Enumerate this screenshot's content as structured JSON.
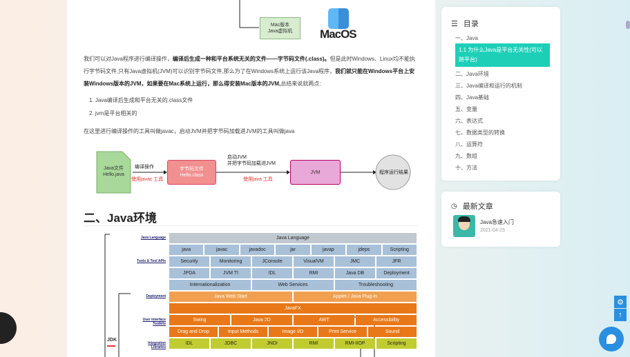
{
  "article": {
    "macos_box": "Mac版本\nJava虚拟机",
    "macos_logo": "MacOS",
    "para1_a": "我们可以对Java程序进行编译操作，",
    "para1_b": "编译后生成一种和平台系统无关的文件——字节码文件(.class)。",
    "para1_c": "但是此时Windows、Linux均不能执行字节码文件,只有Java虚拟机(JVM)可以识别字节码文件,那么为了在Windows系统上运行该Java程序，",
    "para1_d": "我们就只能在Windows平台上安装Windows版本的JVM，如果要在Mac系统上运行，那么得安装Mac版本的JVM,",
    "para1_e": "总结来说就两点:",
    "list": [
      "1. Java编译后生成和平台无关的.class文件",
      "2. jvm是平台相关的"
    ],
    "para2": "在这里进行编译操作的工具叫做javac，启动JVM并把字节码加载进JVM的工具叫做java",
    "flow": {
      "java_file": "Java文件\nHello.java",
      "compile": "编译操作",
      "javac_tool": "使用javac 工具",
      "bytecode": "字节码文件\nHello.class",
      "load": "启动JVM\n并把字节码加载进JVM",
      "java_tool": "使用java 工具",
      "jvm": "JVM",
      "result": "程序运行结果"
    },
    "h2": "二、Java环境",
    "jdk_label": "JDK",
    "diagram": {
      "rows": [
        {
          "label": "Java Language",
          "cells": [
            "Java Language"
          ]
        },
        {
          "label": "",
          "cells": [
            "java",
            "javac",
            "javadoc",
            "jar",
            "javap",
            "jdeps",
            "Scripting"
          ]
        },
        {
          "label": "Tools & Tool APIs",
          "cells": [
            "Security",
            "Monitoring",
            "JConsole",
            "VisualVM",
            "JMC",
            "JFR"
          ]
        },
        {
          "label": "",
          "cells": [
            "JPDA",
            "JVM TI",
            "IDL",
            "RMI",
            "Java DB",
            "Deployment"
          ]
        },
        {
          "label": "",
          "cells": [
            "Internationalization",
            "Web Services",
            "Troubleshooting"
          ]
        },
        {
          "label": "Deployment",
          "cells": [
            "Java Web Start",
            "Applet / Java Plug-in"
          ]
        },
        {
          "label": "",
          "cells": [
            "JavaFX"
          ]
        },
        {
          "label": "User Interface Toolkits",
          "cells": [
            "Swing",
            "Java 2D",
            "AWT",
            "Accessibility"
          ]
        },
        {
          "label": "",
          "cells": [
            "Drag and Drop",
            "Input Methods",
            "Image I/O",
            "Print Service",
            "Sound"
          ]
        },
        {
          "label": "Integration Libraries",
          "cells": [
            "IDL",
            "JDBC",
            "JNDI",
            "RMI",
            "RMI-IIOP",
            "Scripting"
          ]
        }
      ]
    }
  },
  "toc": {
    "title": "目录",
    "items": [
      "一、Java",
      "1.1 为什么Java是平台无关性(可以跨平台)",
      "二、Java环境",
      "三、Java编译和运行的机制",
      "四、Java基础",
      "五、变量",
      "六、表达式",
      "七、数据类型的转换",
      "八、运算符",
      "九、数组",
      "十、方法"
    ]
  },
  "recent": {
    "title": "最新文章",
    "post_title": "Java急速入门",
    "post_date": "2021-04-23"
  },
  "colors": {
    "accent": "#1ecfb8",
    "blue": "#2a8fe0"
  }
}
